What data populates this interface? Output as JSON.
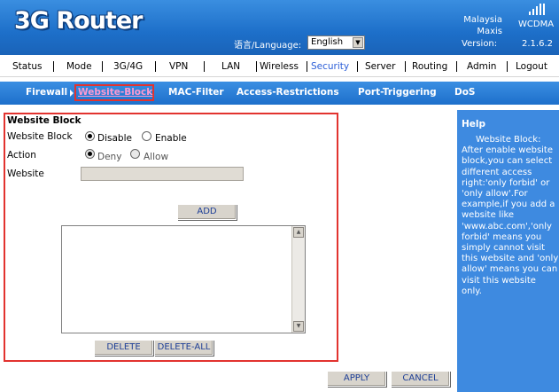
{
  "header": {
    "logo": "3G Router",
    "language_label": "语言/Language:",
    "language_value": "English",
    "carrier_line1": "Malaysia",
    "carrier_line2": "Maxis",
    "network": "WCDMA",
    "version_label": "Version:",
    "version_value": "2.1.6.2"
  },
  "mainnav": {
    "items": [
      "Status",
      "Mode",
      "3G/4G",
      "VPN",
      "LAN",
      "Wireless",
      "Security",
      "Server",
      "Routing",
      "Admin",
      "Logout"
    ],
    "active": "Security"
  },
  "subnav": {
    "items": [
      "Firewall",
      "Website-Block",
      "MAC-Filter",
      "Access-Restrictions",
      "Port-Triggering",
      "DoS"
    ],
    "active": "Website-Block"
  },
  "form": {
    "title": "Website Block",
    "block_label": "Website Block",
    "block_options": [
      "Disable",
      "Enable"
    ],
    "block_selected": "Disable",
    "action_label": "Action",
    "action_options": [
      "Deny",
      "Allow"
    ],
    "action_selected": "Deny",
    "website_label": "Website",
    "website_value": "",
    "add_label": "ADD",
    "delete_label": "DELETE",
    "delete_all_label": "DELETE-ALL",
    "apply_label": "APPLY",
    "cancel_label": "CANCEL"
  },
  "help": {
    "title": "Help",
    "text": "Website Block: After enable website block,you can select different access right:'only forbid' or 'only allow'.For example,if you add a website like 'www.abc.com','only forbid' means you simply cannot visit this website and 'only allow' means you can visit this website only."
  }
}
